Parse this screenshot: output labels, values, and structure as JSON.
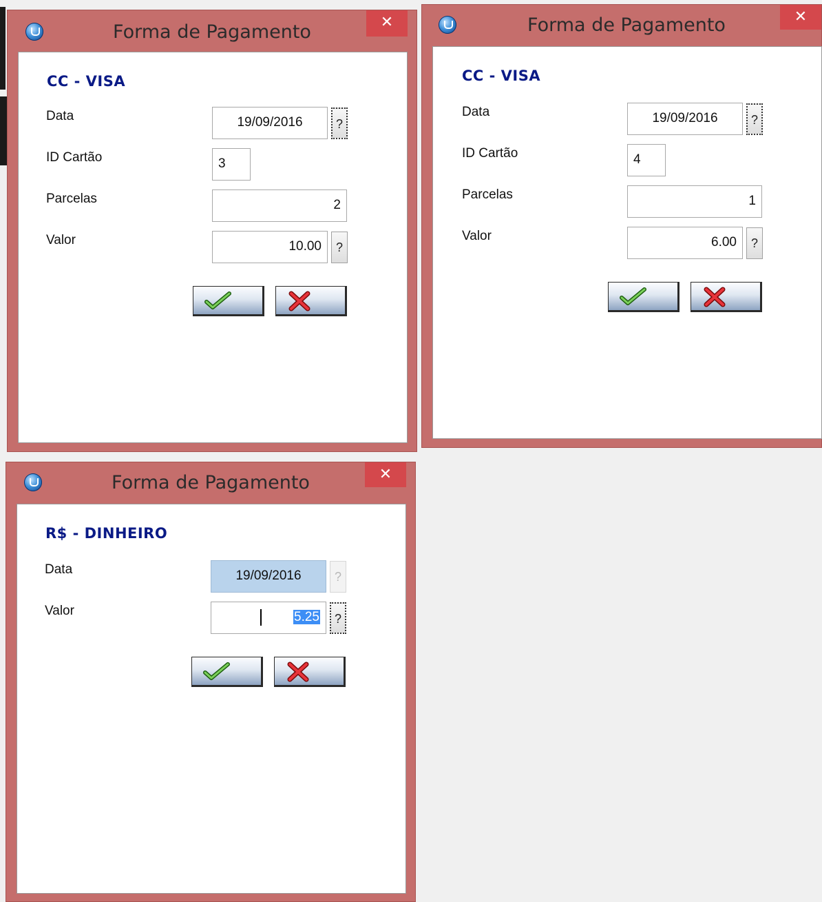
{
  "windows": [
    {
      "title": "Forma de Pagamento",
      "close_glyph": "✕",
      "section_title": "CC - VISA",
      "fields": [
        {
          "label": "Data",
          "value": "19/09/2016",
          "has_help": true
        },
        {
          "label": "ID Cartão",
          "value": "3"
        },
        {
          "label": "Parcelas",
          "value": "2"
        },
        {
          "label": "Valor",
          "value": "10.00",
          "has_help": true
        }
      ],
      "help_glyph": "?",
      "buttons": {
        "confirm_icon": "green-check-icon",
        "cancel_icon": "red-x-icon"
      }
    },
    {
      "title": "Forma de Pagamento",
      "close_glyph": "✕",
      "section_title": "CC - VISA",
      "fields": [
        {
          "label": "Data",
          "value": "19/09/2016",
          "has_help": true
        },
        {
          "label": "ID Cartão",
          "value": "4"
        },
        {
          "label": "Parcelas",
          "value": "1"
        },
        {
          "label": "Valor",
          "value": "6.00",
          "has_help": true
        }
      ],
      "help_glyph": "?",
      "buttons": {
        "confirm_icon": "green-check-icon",
        "cancel_icon": "red-x-icon"
      }
    },
    {
      "title": "Forma de Pagamento",
      "close_glyph": "✕",
      "section_title": "R$ - DINHEIRO",
      "fields": [
        {
          "label": "Data",
          "value": "19/09/2016",
          "has_help": true,
          "disabled": true
        },
        {
          "label": "Valor",
          "value": "5.25",
          "has_help": true,
          "selected": true
        }
      ],
      "help_glyph": "?",
      "buttons": {
        "confirm_icon": "green-check-icon",
        "cancel_icon": "red-x-icon"
      }
    }
  ],
  "colors": {
    "frame": "#c56e6c",
    "close_button": "#d4484c",
    "section_title": "#0a1a86",
    "disabled_field": "#b9d3ec",
    "selection": "#3d8ef5",
    "desktop": "#f0f0f0"
  }
}
